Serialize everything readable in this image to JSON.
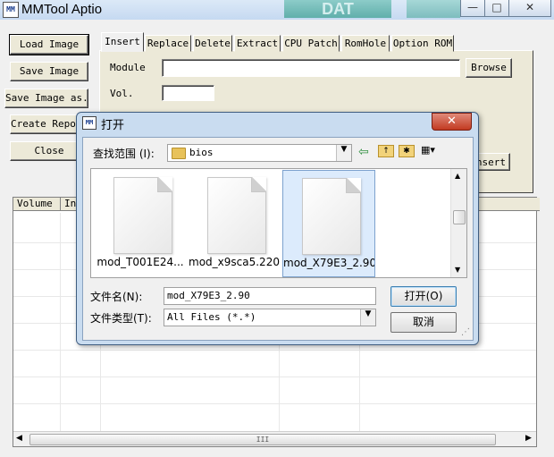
{
  "window": {
    "title": "MMTool Aptio",
    "icon_text": "MM",
    "banner_text": "DAT",
    "minimize_glyph": "—",
    "maximize_glyph": "□",
    "close_glyph": "✕"
  },
  "left_buttons": {
    "load_image": "Load Image",
    "save_image": "Save Image",
    "save_image_as": "Save Image as..",
    "create_report": "Create Report",
    "close": "Close"
  },
  "tabs": [
    "Insert",
    "Replace",
    "Delete",
    "Extract",
    "CPU Patch",
    "RomHole",
    "Option ROM"
  ],
  "insert_panel": {
    "module_label": "Module",
    "module_value": "",
    "browse_label": "Browse",
    "vol_label": "Vol.",
    "vol_value": "",
    "insert_button_label": "Insert"
  },
  "table": {
    "columns": [
      "Volume",
      "In"
    ],
    "scroll_thumb": "III"
  },
  "dialog": {
    "title": "打开",
    "look_in_label": "查找范围 (I):",
    "look_in_value": "bios",
    "files": [
      {
        "name": "mod_T001E24...",
        "selected": false
      },
      {
        "name": "mod_x9sca5.220",
        "selected": false
      },
      {
        "name": "mod_X79E3_2.90",
        "selected": true
      }
    ],
    "filename_label": "文件名(N):",
    "filename_value": "mod_X79E3_2.90",
    "filetype_label": "文件类型(T):",
    "filetype_value": "All Files (*.*)",
    "open_button": "打开(O)",
    "cancel_button": "取消",
    "close_glyph": "✕"
  },
  "colors": {
    "dialog_frame": "#c9dcf0",
    "selection": "#dcebfc",
    "close_red": "#c23a21"
  }
}
